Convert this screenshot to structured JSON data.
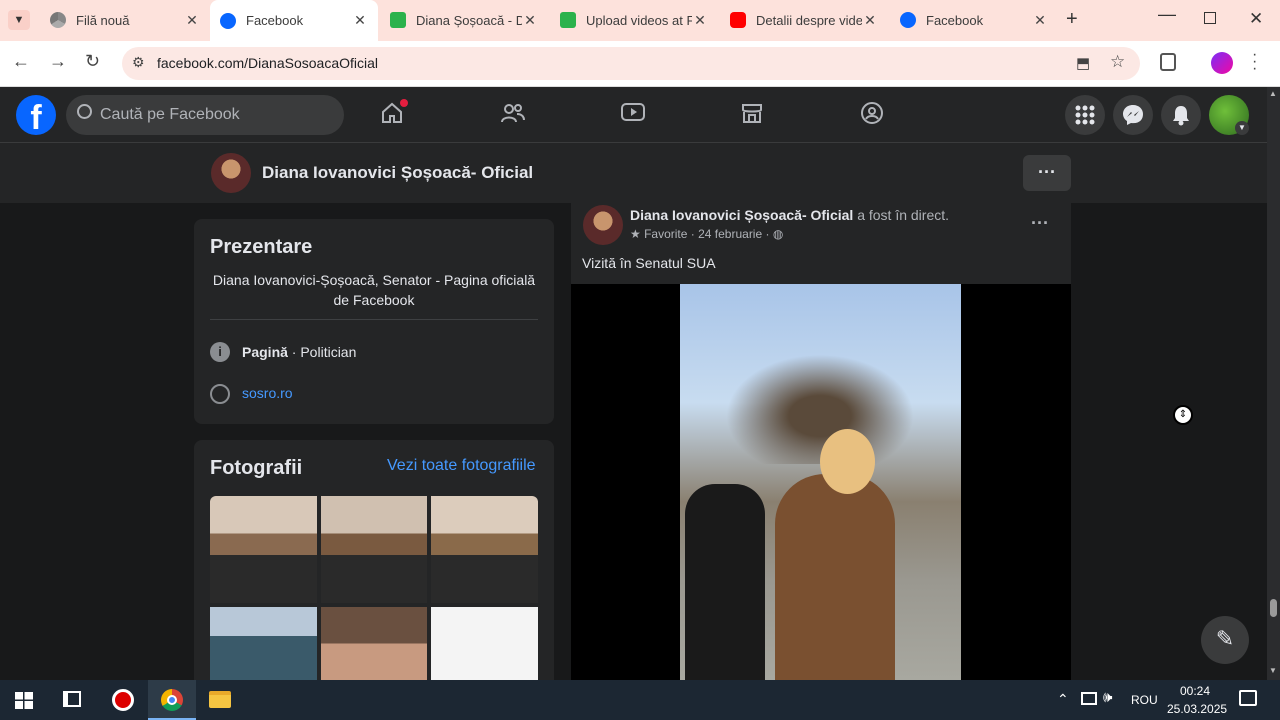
{
  "browser": {
    "tabs": [
      {
        "label": "Filă nouă"
      },
      {
        "label": "Facebook"
      },
      {
        "label": "Diana Șoșoacă - D"
      },
      {
        "label": "Upload videos at F"
      },
      {
        "label": "Detalii despre vide"
      },
      {
        "label": "Facebook"
      }
    ],
    "url": "facebook.com/DianaSosoacaOficial"
  },
  "fb": {
    "search_placeholder": "Caută pe Facebook"
  },
  "page": {
    "name": "Diana Iovanovici Șoșoacă- Oficial",
    "more": "···"
  },
  "intro": {
    "title": "Prezentare",
    "bio": "Diana Iovanovici-Șoșoacă, Senator - Pagina oficială de Facebook",
    "category_bold": "Pagină",
    "category_rest": " · Politician",
    "website": "sosro.ro"
  },
  "photos": {
    "title": "Fotografii",
    "see_all": "Vezi toate fotografiile"
  },
  "post": {
    "author": "Diana Iovanovici Șoșoacă- Oficial",
    "action": " a fost în direct.",
    "meta": "Favorite · 24 februarie ·",
    "text": "Vizită în Senatul SUA",
    "more": "···"
  },
  "taskbar": {
    "lang": "ROU",
    "time": "00:24",
    "date": "25.03.2025"
  },
  "colors": {
    "fb_blue": "#0866ff",
    "link": "#4599ff",
    "tab_bar": "#fde2dc"
  }
}
